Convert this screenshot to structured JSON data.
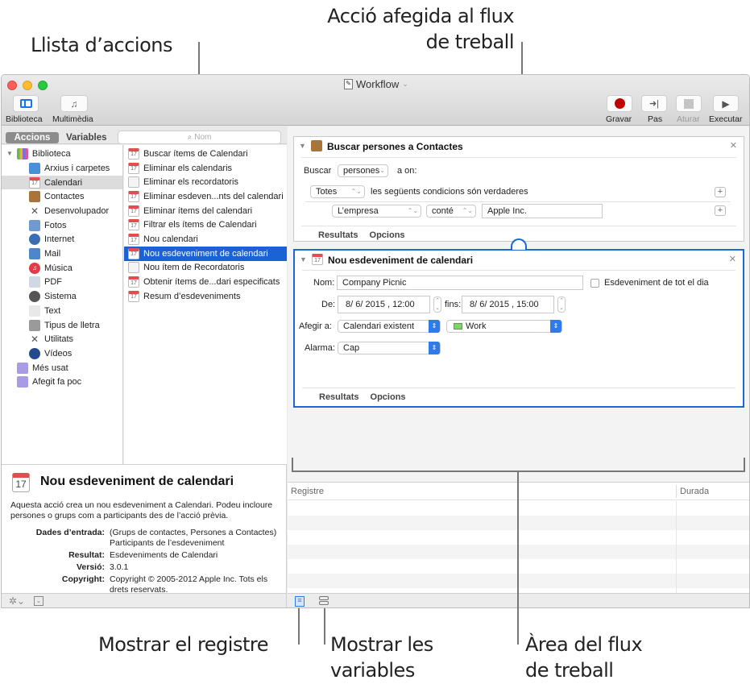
{
  "callouts": {
    "action_list": "Llista d’accions",
    "action_added_line1": "Acció afegida al flux",
    "action_added_line2": "de treball",
    "show_log": "Mostrar el registre",
    "show_variables_line1": "Mostrar les",
    "show_variables_line2": "variables",
    "workflow_area_line1": "Àrea del flux",
    "workflow_area_line2": "de treball"
  },
  "window": {
    "title": "Workflow",
    "toolbar_left": [
      {
        "label": "Biblioteca",
        "icon": "sidebar-icon"
      },
      {
        "label": "Multimèdia",
        "icon": "media-icon"
      }
    ],
    "toolbar_right": [
      {
        "label": "Gravar",
        "icon": "record-icon",
        "enabled": true
      },
      {
        "label": "Pas",
        "icon": "step-icon",
        "enabled": true
      },
      {
        "label": "Aturar",
        "icon": "stop-icon",
        "enabled": false
      },
      {
        "label": "Executar",
        "icon": "run-icon",
        "enabled": true
      }
    ],
    "colors": {
      "accent": "#1a63d4",
      "record": "#c00000",
      "selection_blue": "#1a63d4"
    }
  },
  "left": {
    "tabs": {
      "actions": "Accions",
      "variables": "Variables"
    },
    "search_placeholder": "Nom",
    "library": {
      "root": "Biblioteca",
      "items": [
        {
          "label": "Arxius i carpetes",
          "icon": "finder-icon"
        },
        {
          "label": "Calendari",
          "icon": "calendar-icon",
          "selected": true
        },
        {
          "label": "Contactes",
          "icon": "contacts-icon"
        },
        {
          "label": "Desenvolupador",
          "icon": "developer-tools-icon"
        },
        {
          "label": "Fotos",
          "icon": "photos-icon"
        },
        {
          "label": "Internet",
          "icon": "globe-icon"
        },
        {
          "label": "Mail",
          "icon": "mail-icon"
        },
        {
          "label": "Música",
          "icon": "music-icon"
        },
        {
          "label": "PDF",
          "icon": "pdf-icon"
        },
        {
          "label": "Sistema",
          "icon": "system-icon"
        },
        {
          "label": "Text",
          "icon": "text-icon"
        },
        {
          "label": "Tipus de lletra",
          "icon": "font-icon"
        },
        {
          "label": "Utilitats",
          "icon": "utilities-icon"
        },
        {
          "label": "Vídeos",
          "icon": "video-icon"
        }
      ],
      "smart_groups": [
        {
          "label": "Més usat",
          "icon": "smart-folder-icon"
        },
        {
          "label": "Afegit fa poc",
          "icon": "smart-folder-icon"
        }
      ]
    },
    "actions": [
      {
        "label": "Buscar ítems de Calendari",
        "icon": "calendar-icon"
      },
      {
        "label": "Eliminar els calendaris",
        "icon": "calendar-icon"
      },
      {
        "label": "Eliminar els recordatoris",
        "icon": "reminders-icon"
      },
      {
        "label": "Eliminar esdeven...nts del calendari",
        "icon": "calendar-icon"
      },
      {
        "label": "Eliminar ítems del calendari",
        "icon": "calendar-icon"
      },
      {
        "label": "Filtrar els ítems de Calendari",
        "icon": "calendar-icon"
      },
      {
        "label": "Nou calendari",
        "icon": "calendar-icon"
      },
      {
        "label": "Nou esdeveniment de calendari",
        "icon": "calendar-icon",
        "selected": true
      },
      {
        "label": "Nou ítem de Recordatoris",
        "icon": "reminders-icon"
      },
      {
        "label": "Obtenir ítems de...dari especificats",
        "icon": "calendar-icon"
      },
      {
        "label": "Resum d’esdeveniments",
        "icon": "calendar-icon"
      }
    ],
    "description": {
      "title": "Nou esdeveniment de calendari",
      "icon_day": "17",
      "summary": "Aquesta acció crea un nou esdeveniment a Calendari. Podeu incloure persones o grups com a participants des de l’acció prèvia.",
      "fields": [
        {
          "key": "Dades d’entrada:",
          "value": "(Grups de contactes, Persones a Contactes) Participants de l’esdeveniment"
        },
        {
          "key": "Resultat:",
          "value": "Esdeveniments de Calendari"
        },
        {
          "key": "Versió:",
          "value": "3.0.1"
        },
        {
          "key": "Copyright:",
          "value": "Copyright © 2005-2012 Apple Inc. Tots els drets reservats."
        }
      ]
    }
  },
  "workflow": {
    "action1": {
      "title": "Buscar persones a Contactes",
      "find_label": "Buscar",
      "find_value": "persones",
      "where_label": "a on:",
      "match_value": "Totes",
      "match_text": "les següents condicions són verdaderes",
      "cond_field": "L’empresa",
      "cond_op": "conté",
      "cond_value": "Apple Inc.",
      "footer": {
        "results": "Resultats",
        "options": "Opcions"
      }
    },
    "action2": {
      "title": "Nou esdeveniment de calendari",
      "name_label": "Nom:",
      "name_value": "Company Picnic",
      "allday_label": "Esdeveniment de tot el dia",
      "allday_checked": false,
      "from_label": "De:",
      "from_value": "8/ 6/ 2015 ,  12:00",
      "to_label": "fins:",
      "to_value": "8/ 6/ 2015 ,  15:00",
      "addto_label": "Afegir a:",
      "addto_value": "Calendari existent",
      "calendar_value": "Work",
      "calendar_color": "#7ed36b",
      "alarm_label": "Alarma:",
      "alarm_value": "Cap",
      "footer": {
        "results": "Resultats",
        "options": "Opcions"
      }
    }
  },
  "log": {
    "col_log": "Registre",
    "col_duration": "Durada"
  }
}
